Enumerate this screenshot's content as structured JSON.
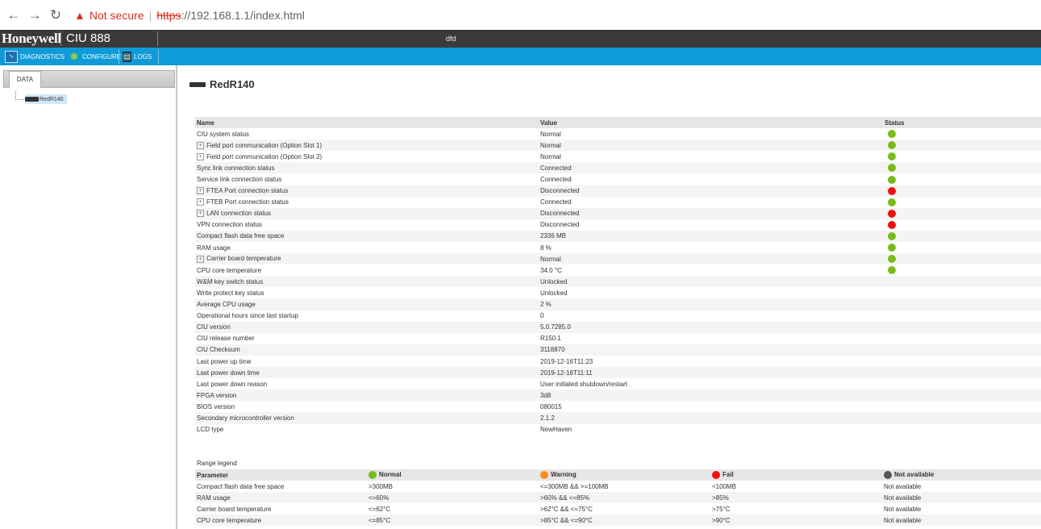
{
  "browser": {
    "security_label": "Not secure",
    "url_protocol": "https",
    "url_rest": "://192.168.1.1/index.html"
  },
  "app": {
    "brand": "Honeywell",
    "product": "CIU 888",
    "user": "dfd"
  },
  "tabs": [
    {
      "label": "DIAGNOSTICS",
      "icon": "diagnostics-icon"
    },
    {
      "label": "CONFIGURE",
      "icon": "gear-icon"
    },
    {
      "label": "LOGS",
      "icon": "logs-icon"
    }
  ],
  "left_panel": {
    "tab_label": "DATA",
    "tree": [
      {
        "label": "RedR140",
        "icon": "device-icon"
      }
    ]
  },
  "device": {
    "name": "RedR140"
  },
  "status_colors": {
    "green": "#79bc1a",
    "red": "#ee1111",
    "orange": "#ff8c1a",
    "gray": "#555555"
  },
  "status_table": {
    "headers": [
      "Name",
      "Value",
      "Status"
    ],
    "rows": [
      {
        "name": "CIU system status",
        "value": "Normal",
        "status": "green",
        "expandable": false
      },
      {
        "name": "Field port communication (Option Slot 1)",
        "value": "Normal",
        "status": "green",
        "expandable": true
      },
      {
        "name": "Field port communication (Option Slot 2)",
        "value": "Normal",
        "status": "green",
        "expandable": true
      },
      {
        "name": "Sync link connection status",
        "value": "Connected",
        "status": "green",
        "expandable": false
      },
      {
        "name": "Service link connection status",
        "value": "Connected",
        "status": "green",
        "expandable": false
      },
      {
        "name": "FTEA Port connection status",
        "value": "Disconnected",
        "status": "red",
        "expandable": true
      },
      {
        "name": "FTEB Port connection status",
        "value": "Connected",
        "status": "green",
        "expandable": true
      },
      {
        "name": "LAN connection status",
        "value": "Disconnected",
        "status": "red",
        "expandable": true
      },
      {
        "name": "VPN connection status",
        "value": "Disconnected",
        "status": "red",
        "expandable": false
      },
      {
        "name": "Compact flash data free space",
        "value": "2336 MB",
        "status": "green",
        "expandable": false
      },
      {
        "name": "RAM usage",
        "value": "8 %",
        "status": "green",
        "expandable": false
      },
      {
        "name": "Carrier board temperature",
        "value": "Normal",
        "status": "green",
        "expandable": true
      },
      {
        "name": "CPU core temperature",
        "value": "34.0 °C",
        "status": "green",
        "expandable": false
      },
      {
        "name": "W&M key switch status",
        "value": "Unlocked",
        "status": "",
        "expandable": false
      },
      {
        "name": "Write protect key status",
        "value": "Unlocked",
        "status": "",
        "expandable": false
      },
      {
        "name": "Average CPU usage",
        "value": "2 %",
        "status": "",
        "expandable": false
      },
      {
        "name": "Operational hours since last startup",
        "value": "0",
        "status": "",
        "expandable": false
      },
      {
        "name": "CIU version",
        "value": "5.0.7285.0",
        "status": "",
        "expandable": false
      },
      {
        "name": "CIU release number",
        "value": "R150.1",
        "status": "",
        "expandable": false
      },
      {
        "name": "CIU Checksum",
        "value": "3118870",
        "status": "",
        "expandable": false
      },
      {
        "name": "Last power up time",
        "value": "2019-12-16T11:23",
        "status": "",
        "expandable": false
      },
      {
        "name": "Last power down time",
        "value": "2019-12-16T11:11",
        "status": "",
        "expandable": false
      },
      {
        "name": "Last power down reason",
        "value": "User initiated shutdown/restart",
        "status": "",
        "expandable": false
      },
      {
        "name": "FPGA version",
        "value": "3d8",
        "status": "",
        "expandable": false
      },
      {
        "name": "BIOS version",
        "value": "080015",
        "status": "",
        "expandable": false
      },
      {
        "name": "Secondary microcontroller version",
        "value": "2.1.2",
        "status": "",
        "expandable": false
      },
      {
        "name": "LCD type",
        "value": "NewHaven",
        "status": "",
        "expandable": false
      }
    ]
  },
  "legend": {
    "title": "Range legend",
    "headers": [
      {
        "label": "Parameter",
        "color": ""
      },
      {
        "label": "Normal",
        "color": "green"
      },
      {
        "label": "Warning",
        "color": "orange"
      },
      {
        "label": "Fail",
        "color": "red"
      },
      {
        "label": "Not available",
        "color": "gray"
      }
    ],
    "rows": [
      [
        "Compact flash data free space",
        ">300MB",
        "<=300MB && >=100MB",
        "<100MB",
        "Not available"
      ],
      [
        "RAM usage",
        "<=60%",
        ">60% && <=85%",
        ">85%",
        "Not available"
      ],
      [
        "Carrier board temperature",
        "<=62°C",
        ">62°C && <=75°C",
        ">75°C",
        "Not available"
      ],
      [
        "CPU core temperature",
        "<=85°C",
        ">85°C && <=90°C",
        ">90°C",
        "Not available"
      ]
    ]
  }
}
